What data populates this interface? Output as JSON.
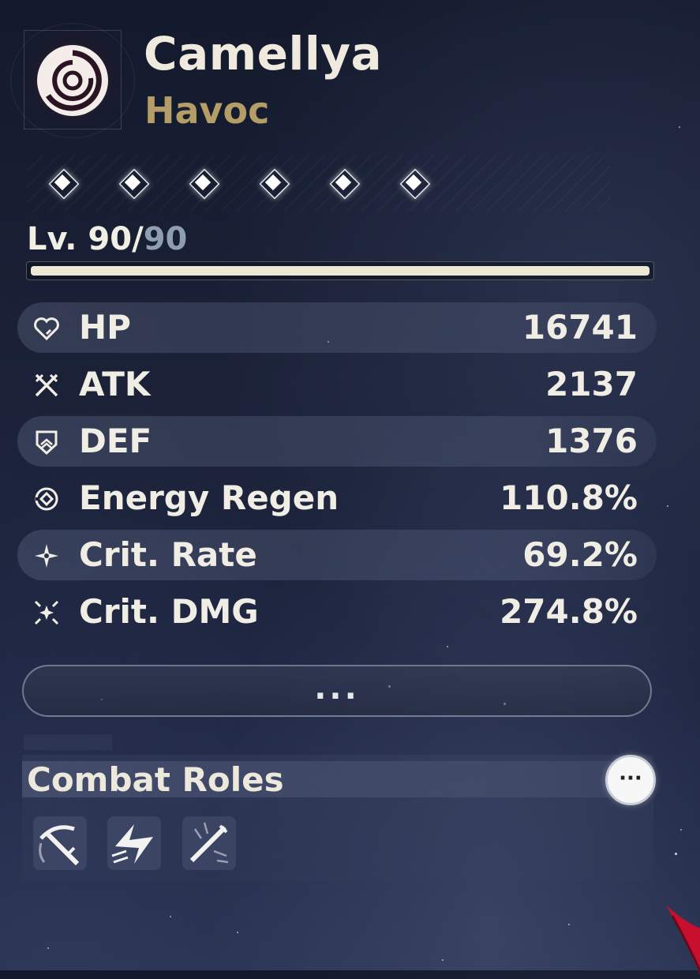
{
  "character": {
    "name": "Camellya",
    "element": "Havoc",
    "element_color": "#b59d67",
    "emblem_icon": "havoc-swirl-icon"
  },
  "resonance_chain": {
    "nodes": 6,
    "icon": "diamond-node-icon"
  },
  "level": {
    "current": "Lv. 90/",
    "max": "90",
    "progress": 1.0
  },
  "stats": [
    {
      "label": "HP",
      "value": "16741",
      "icon": "heart-icon"
    },
    {
      "label": "ATK",
      "value": "2137",
      "icon": "crossed-swords-icon"
    },
    {
      "label": "DEF",
      "value": "1376",
      "icon": "shield-icon"
    },
    {
      "label": "Energy Regen",
      "value": "110.8%",
      "icon": "energy-regen-icon"
    },
    {
      "label": "Crit. Rate",
      "value": "69.2%",
      "icon": "crit-rate-star-icon"
    },
    {
      "label": "Crit. DMG",
      "value": "274.8%",
      "icon": "crit-dmg-burst-icon"
    }
  ],
  "expand_button": {
    "label": "..."
  },
  "combat_roles": {
    "title": "Combat Roles",
    "more_label": "···",
    "roles": [
      {
        "icon": "scythe-slash-icon"
      },
      {
        "icon": "lightning-dash-icon"
      },
      {
        "icon": "sword-strike-icon"
      }
    ]
  }
}
